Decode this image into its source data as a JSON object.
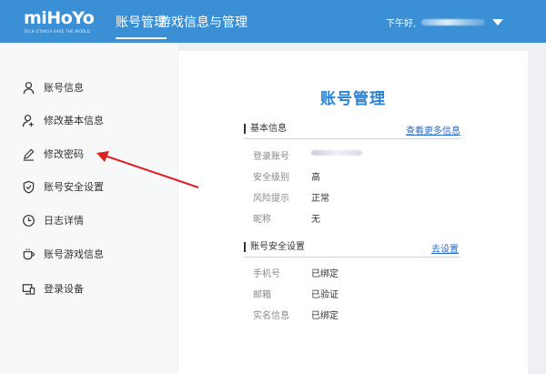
{
  "header": {
    "logo_text": "miHoYo",
    "logo_tagline": "TECH OTAKUS SAVE THE WORLD",
    "nav": [
      "账号管理",
      "游戏信息与管理"
    ],
    "greeting": "下午好,",
    "active_color": "#3a8fd5"
  },
  "sidebar": {
    "items": [
      {
        "label": "账号信息",
        "icon": "user-icon"
      },
      {
        "label": "修改基本信息",
        "icon": "user-edit-icon"
      },
      {
        "label": "修改密码",
        "icon": "pencil-icon"
      },
      {
        "label": "账号安全设置",
        "icon": "shield-check-icon"
      },
      {
        "label": "日志详情",
        "icon": "clock-icon"
      },
      {
        "label": "账号游戏信息",
        "icon": "cup-icon"
      },
      {
        "label": "登录设备",
        "icon": "devices-icon"
      }
    ]
  },
  "main": {
    "title": "账号管理",
    "basic": {
      "heading": "基本信息",
      "link": "查看更多信息",
      "rows": [
        {
          "label": "登录账号",
          "value": ""
        },
        {
          "label": "安全级别",
          "value": "高"
        },
        {
          "label": "风险提示",
          "value": "正常"
        },
        {
          "label": "昵称",
          "value": "无"
        }
      ]
    },
    "security": {
      "heading": "账号安全设置",
      "link": "去设置",
      "rows": [
        {
          "label": "手机号",
          "value": "已绑定"
        },
        {
          "label": "邮箱",
          "value": "已验证"
        },
        {
          "label": "实名信息",
          "value": "已绑定"
        }
      ]
    }
  }
}
